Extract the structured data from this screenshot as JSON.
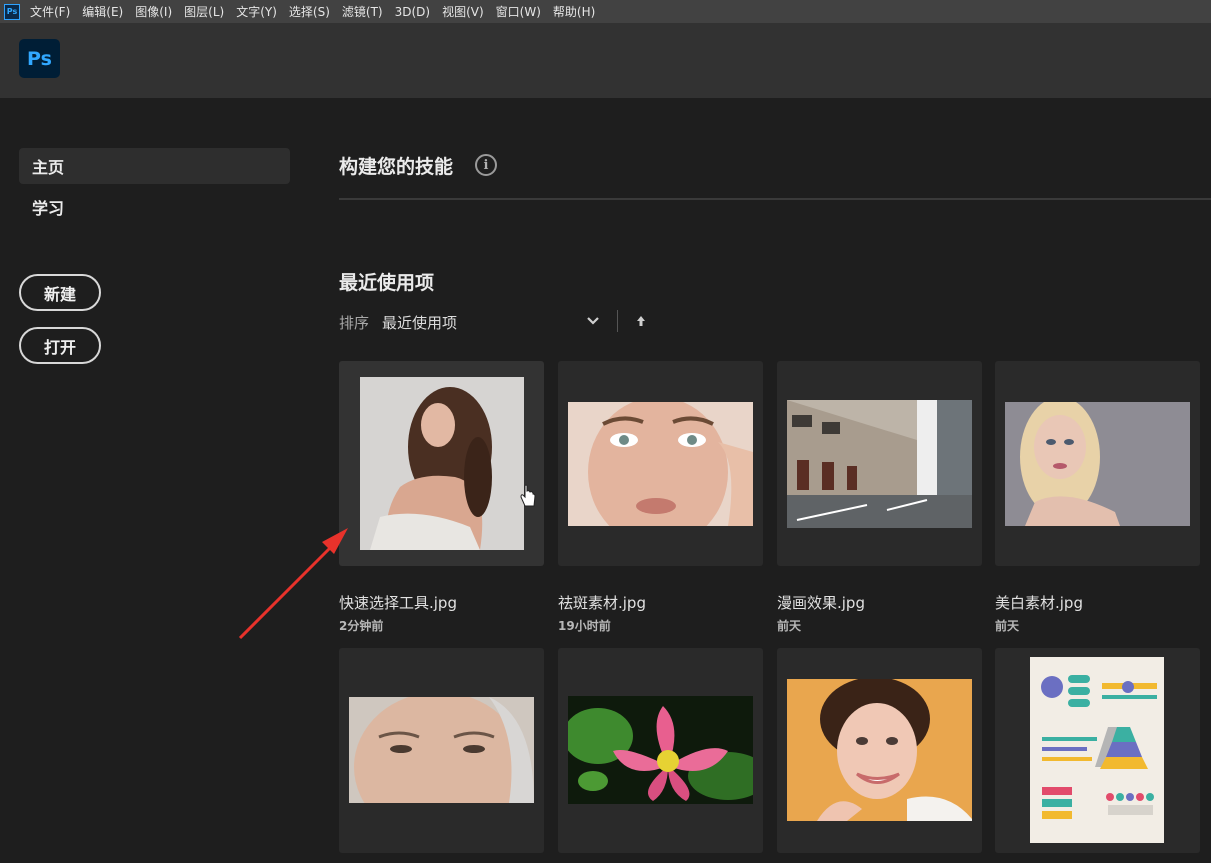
{
  "menubar": {
    "app_icon": "Ps",
    "items": [
      "文件(F)",
      "编辑(E)",
      "图像(I)",
      "图层(L)",
      "文字(Y)",
      "选择(S)",
      "滤镜(T)",
      "3D(D)",
      "视图(V)",
      "窗口(W)",
      "帮助(H)"
    ]
  },
  "header": {
    "logo": "Ps"
  },
  "sidebar": {
    "nav": [
      {
        "label": "主页",
        "active": true
      },
      {
        "label": "学习",
        "active": false
      }
    ],
    "new_button": "新建",
    "open_button": "打开"
  },
  "main": {
    "skills_title": "构建您的技能",
    "info_icon": "i",
    "recent_title": "最近使用项",
    "sort_label": "排序",
    "sort_value": "最近使用项"
  },
  "recent_files": [
    {
      "name": "快速选择工具.jpg",
      "time": "2分钟前",
      "thumb": "portrait-woman-shoulder"
    },
    {
      "name": "祛斑素材.jpg",
      "time": "19小时前",
      "thumb": "face-closeup-freckles"
    },
    {
      "name": "漫画效果.jpg",
      "time": "前天",
      "thumb": "street-buildings"
    },
    {
      "name": "美白素材.jpg",
      "time": "前天",
      "thumb": "blonde-woman"
    },
    {
      "name": "",
      "time": "",
      "thumb": "elderly-woman-face"
    },
    {
      "name": "",
      "time": "",
      "thumb": "lotus-flower"
    },
    {
      "name": "",
      "time": "",
      "thumb": "smiling-woman"
    },
    {
      "name": "",
      "time": "",
      "thumb": "infographic-document"
    }
  ],
  "colors": {
    "background": "#1e1e1e",
    "menubar": "#424242",
    "header": "#323232",
    "card": "#2a2a2a",
    "ps_blue": "#31a8ff",
    "annotation_red": "#e8322b"
  }
}
